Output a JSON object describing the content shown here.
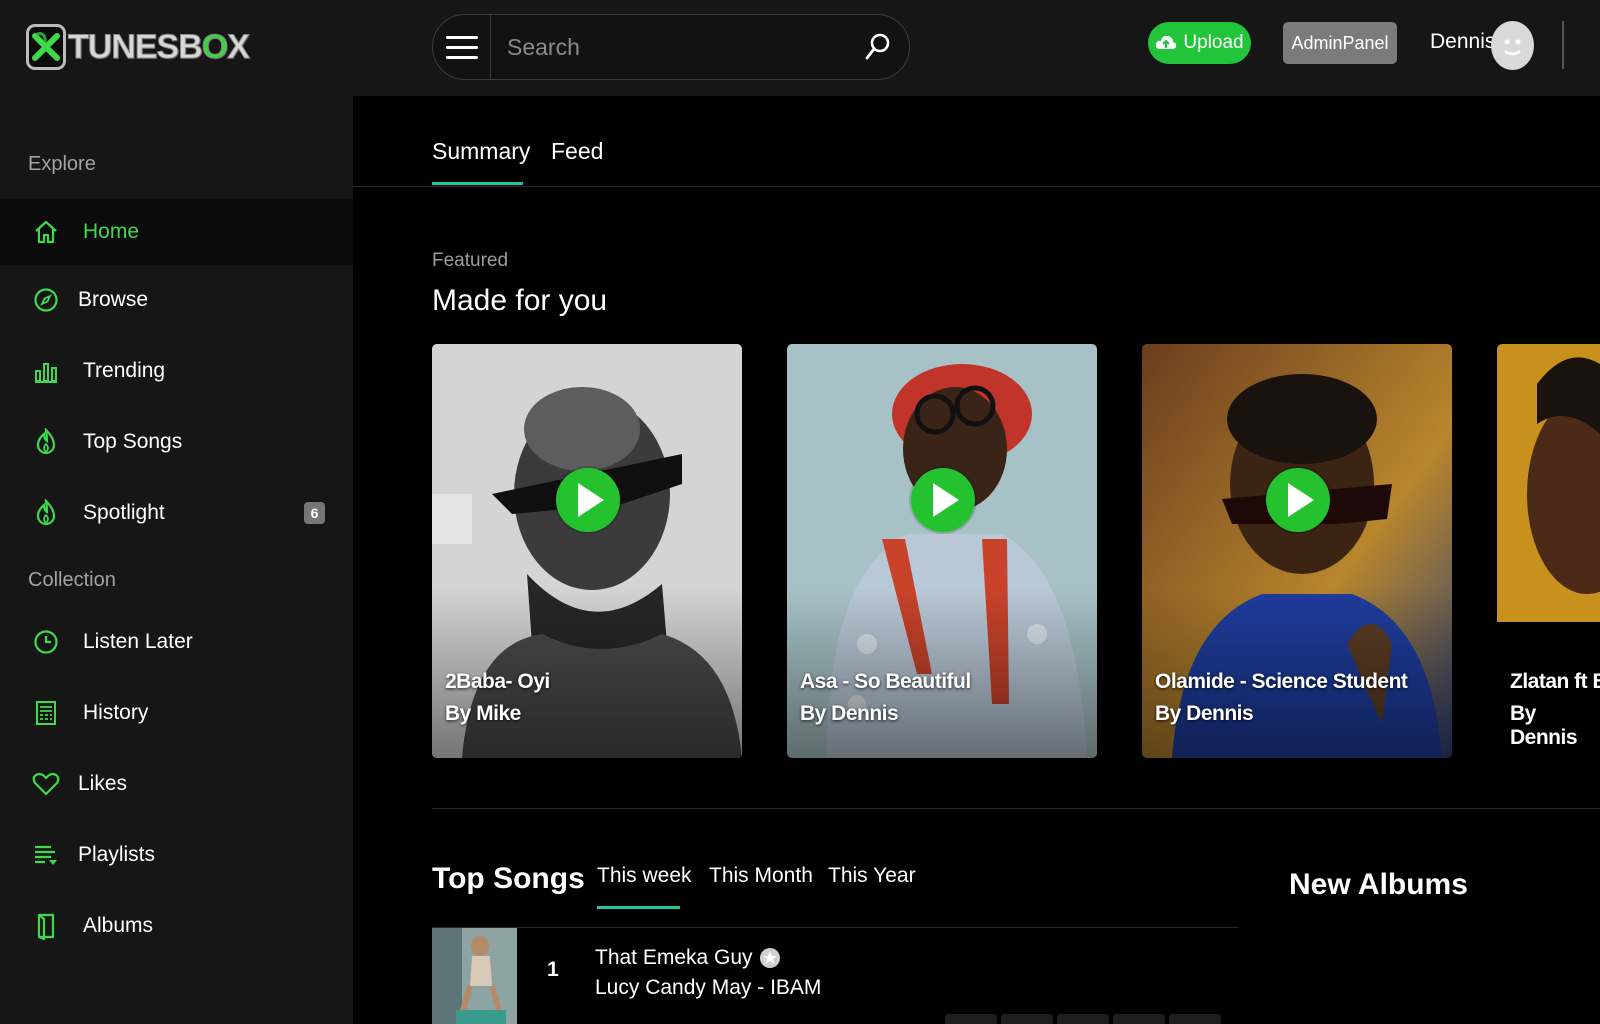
{
  "header": {
    "logo_text": "TUNESBOX",
    "search_placeholder": "Search",
    "upload_label": "Upload",
    "admin_label": "AdminPanel",
    "user_name": "Dennis"
  },
  "sidebar": {
    "explore_label": "Explore",
    "collection_label": "Collection",
    "explore_items": [
      {
        "label": "Home",
        "icon": "home-icon"
      },
      {
        "label": "Browse",
        "icon": "compass-icon"
      },
      {
        "label": "Trending",
        "icon": "bar-chart-icon"
      },
      {
        "label": "Top Songs",
        "icon": "flame-icon"
      },
      {
        "label": "Spotlight",
        "icon": "flame-icon",
        "badge": "6"
      }
    ],
    "collection_items": [
      {
        "label": "Listen Later",
        "icon": "clock-icon"
      },
      {
        "label": "History",
        "icon": "history-icon"
      },
      {
        "label": "Likes",
        "icon": "heart-icon"
      },
      {
        "label": "Playlists",
        "icon": "playlist-icon"
      },
      {
        "label": "Albums",
        "icon": "album-icon"
      }
    ],
    "active_item": "Home"
  },
  "main": {
    "tabs": [
      "Summary",
      "Feed"
    ],
    "active_tab": "Summary",
    "featured_label": "Featured",
    "made_for_you_title": "Made for you",
    "cards": [
      {
        "title": "2Baba- Oyi",
        "by": "By Mike"
      },
      {
        "title": "Asa - So Beautiful",
        "by": "By Dennis"
      },
      {
        "title": "Olamide - Science Student",
        "by": "By Dennis"
      },
      {
        "title": "Zlatan ft B",
        "by": "By Dennis"
      }
    ],
    "top_songs": {
      "title": "Top Songs",
      "periods": [
        "This week",
        "This Month",
        "This Year"
      ],
      "active_period": "This week",
      "songs": [
        {
          "rank": "1",
          "title": "That Emeka Guy",
          "artist": "Lucy Candy May - IBAM"
        }
      ]
    },
    "new_albums_title": "New Albums"
  },
  "colors": {
    "accent_green": "#22c43a",
    "tab_underline": "#24c6a0",
    "sidebar_bg": "#161616",
    "main_bg": "#000000"
  }
}
